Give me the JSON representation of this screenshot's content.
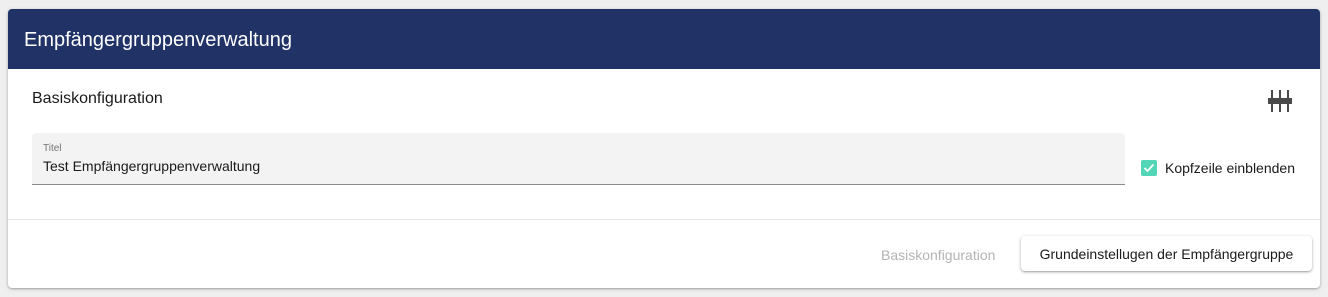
{
  "header": {
    "title": "Empfängergruppenverwaltung"
  },
  "section": {
    "title": "Basiskonfiguration",
    "settings_icon": "sliders-icon"
  },
  "title_field": {
    "label": "Titel",
    "value": "Test Empfängergruppenverwaltung"
  },
  "header_checkbox": {
    "label": "Kopfzeile einblenden",
    "checked": true
  },
  "footer": {
    "previous_step_label": "Basiskonfiguration",
    "next_button_label": "Grundeinstellugen der Empfängergruppe"
  },
  "colors": {
    "header_bg": "#203266",
    "checkbox_accent": "#53d6b8",
    "field_bg": "#f3f3f3"
  }
}
